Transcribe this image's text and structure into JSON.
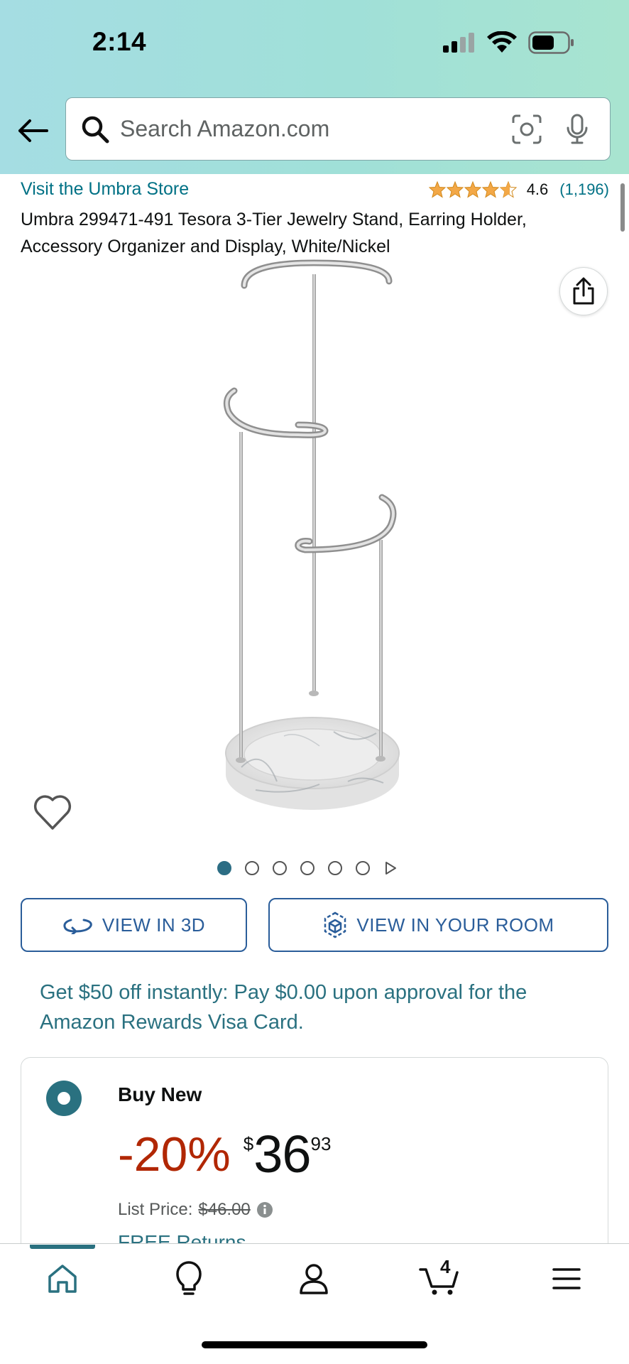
{
  "status_bar": {
    "time": "2:14"
  },
  "search": {
    "placeholder": "Search Amazon.com"
  },
  "product": {
    "store_link": "Visit the Umbra Store",
    "rating_value": "4.6",
    "rating_stars": 4.6,
    "rating_count": "(1,196)",
    "title": "Umbra 299471-491 Tesora 3-Tier Jewelry Stand, Earring Holder, Accessory Organizer and Display, White/Nickel"
  },
  "gallery": {
    "image_count": 6,
    "active_index": 0
  },
  "buttons": {
    "view_3d": "VIEW IN 3D",
    "view_room": "VIEW IN YOUR ROOM"
  },
  "promo": {
    "text": "Get $50 off instantly: Pay $0.00 upon approval for the Amazon Rewards Visa Card."
  },
  "buy_box": {
    "label": "Buy New",
    "discount": "-20%",
    "currency": "$",
    "price_whole": "36",
    "price_fraction": "93",
    "list_price_label": "List Price:",
    "list_price_value": "$46.00",
    "free_returns": "FREE Returns"
  },
  "bottom_nav": {
    "cart_count": "4",
    "active": "home"
  },
  "colors": {
    "link": "#007185",
    "teal": "#2a7180",
    "discount_red": "#b12704",
    "star": "#f3a847",
    "button_blue": "#2a5d9a"
  }
}
